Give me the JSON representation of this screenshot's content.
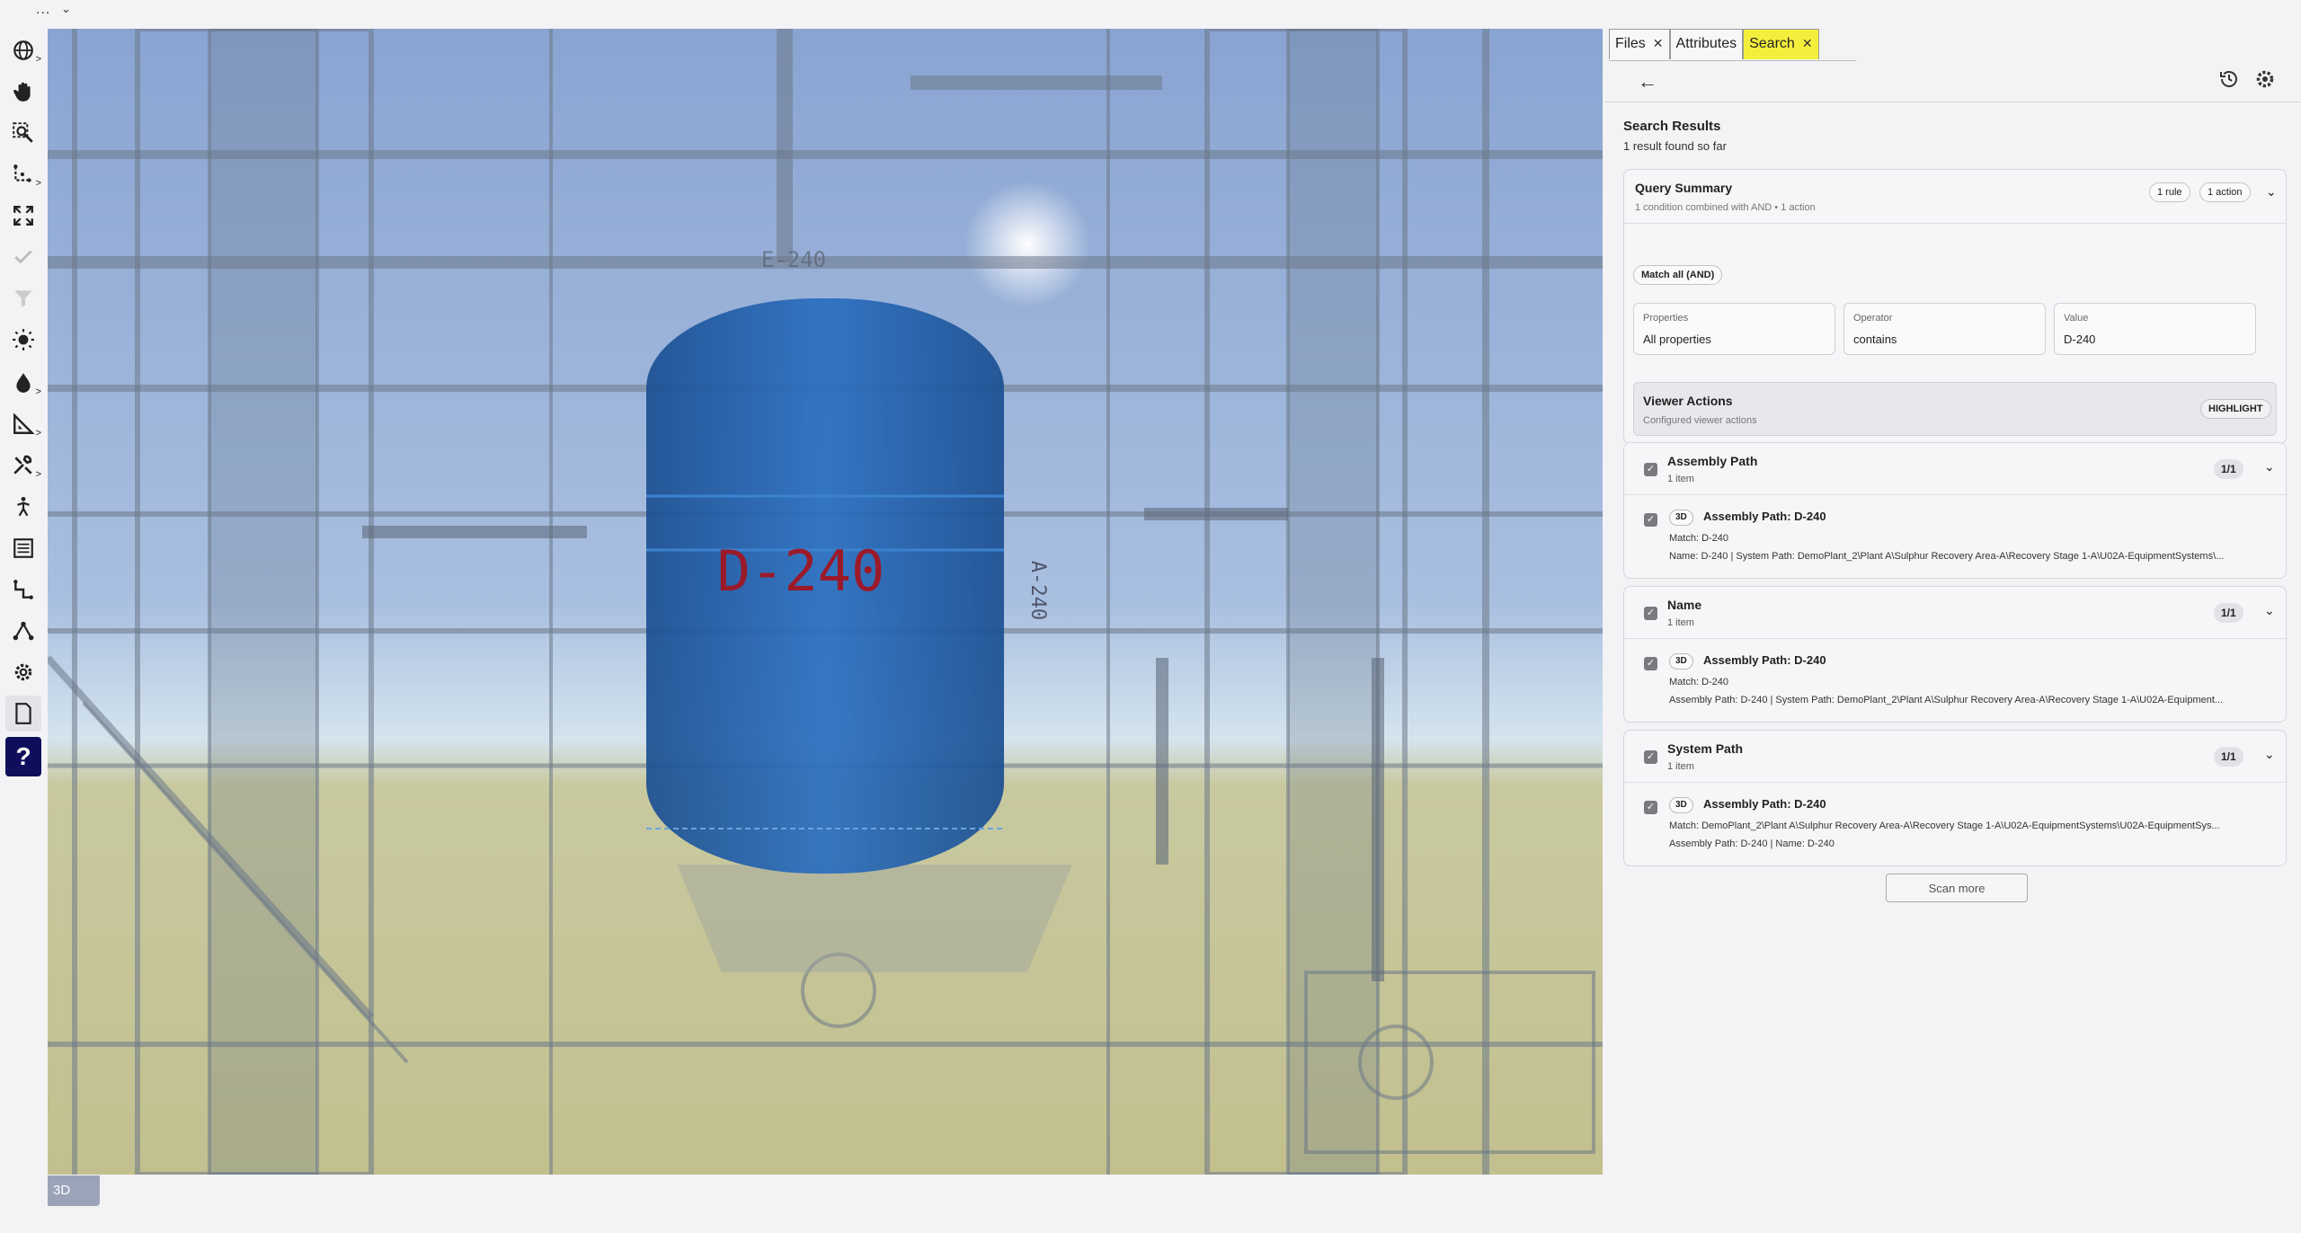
{
  "topbar": {
    "menu": "...",
    "chevron": "⌄"
  },
  "toolbar": {
    "tools": [
      {
        "icon": "globe-icon",
        "sub": ">"
      },
      {
        "icon": "hand-icon",
        "sub": ""
      },
      {
        "icon": "zoom-box-icon",
        "sub": ""
      },
      {
        "icon": "axes-icon",
        "sub": ">"
      },
      {
        "icon": "fullscreen-icon",
        "sub": ""
      },
      {
        "icon": "check-icon",
        "sub": ""
      },
      {
        "icon": "filter-icon",
        "sub": ""
      },
      {
        "icon": "sun-icon",
        "sub": ""
      },
      {
        "icon": "drop-icon",
        "sub": ">"
      },
      {
        "icon": "measure-icon",
        "sub": ">"
      },
      {
        "icon": "tools-icon",
        "sub": ">"
      },
      {
        "icon": "walk-icon",
        "sub": ""
      },
      {
        "icon": "list-icon",
        "sub": ""
      },
      {
        "icon": "path-icon",
        "sub": ""
      },
      {
        "icon": "network-icon",
        "sub": ""
      },
      {
        "icon": "gear-icon",
        "sub": ""
      },
      {
        "icon": "document-icon",
        "sub": ""
      },
      {
        "icon": "help-icon",
        "sub": "?"
      }
    ]
  },
  "viewport": {
    "label": "D-240",
    "label_left": "E-240",
    "label_right": "A-240",
    "mode": "3D",
    "colors": {
      "tank": "#1f63b4",
      "sky": "#8fa9d6",
      "ground": "#cfcf9e"
    }
  },
  "tabs": [
    {
      "label": "Files",
      "close": "✕"
    },
    {
      "label": "Attributes",
      "close": ""
    },
    {
      "label": "Search",
      "close": "✕"
    }
  ],
  "results": {
    "title": "Search Results",
    "subtitle": "1 result found so far"
  },
  "query": {
    "title": "Query Summary",
    "subtitle": "1 condition combined with AND • 1 action",
    "rules": "1 rule",
    "actions": "1 action",
    "match": "Match all (AND)",
    "fields": [
      {
        "label": "Properties",
        "value": "All properties"
      },
      {
        "label": "Operator",
        "value": "contains"
      },
      {
        "label": "Value",
        "value": "D-240"
      }
    ],
    "viewer_actions": {
      "title": "Viewer Actions",
      "subtitle": "Configured viewer actions",
      "action": "HIGHLIGHT"
    }
  },
  "groups": [
    {
      "title": "Assembly Path",
      "count_text": "1 item",
      "ratio": "1/1",
      "item": {
        "badge": "3D",
        "title": "Assembly Path: D-240",
        "lines": [
          "Match: D-240",
          "Name: D-240 | System Path: DemoPlant_2\\Plant A\\Sulphur Recovery Area-A\\Recovery Stage 1-A\\U02A-EquipmentSystems\\..."
        ]
      }
    },
    {
      "title": "Name",
      "count_text": "1 item",
      "ratio": "1/1",
      "item": {
        "badge": "3D",
        "title": "Assembly Path: D-240",
        "lines": [
          "Match: D-240",
          "Assembly Path: D-240 | System Path: DemoPlant_2\\Plant A\\Sulphur Recovery Area-A\\Recovery Stage 1-A\\U02A-Equipment..."
        ]
      }
    },
    {
      "title": "System Path",
      "count_text": "1 item",
      "ratio": "1/1",
      "item": {
        "badge": "3D",
        "title": "Assembly Path: D-240",
        "lines": [
          "Match: DemoPlant_2\\Plant A\\Sulphur Recovery Area-A\\Recovery Stage 1-A\\U02A-EquipmentSystems\\U02A-EquipmentSys...",
          "Assembly Path: D-240 | Name: D-240"
        ]
      }
    }
  ],
  "scan_more": "Scan more"
}
